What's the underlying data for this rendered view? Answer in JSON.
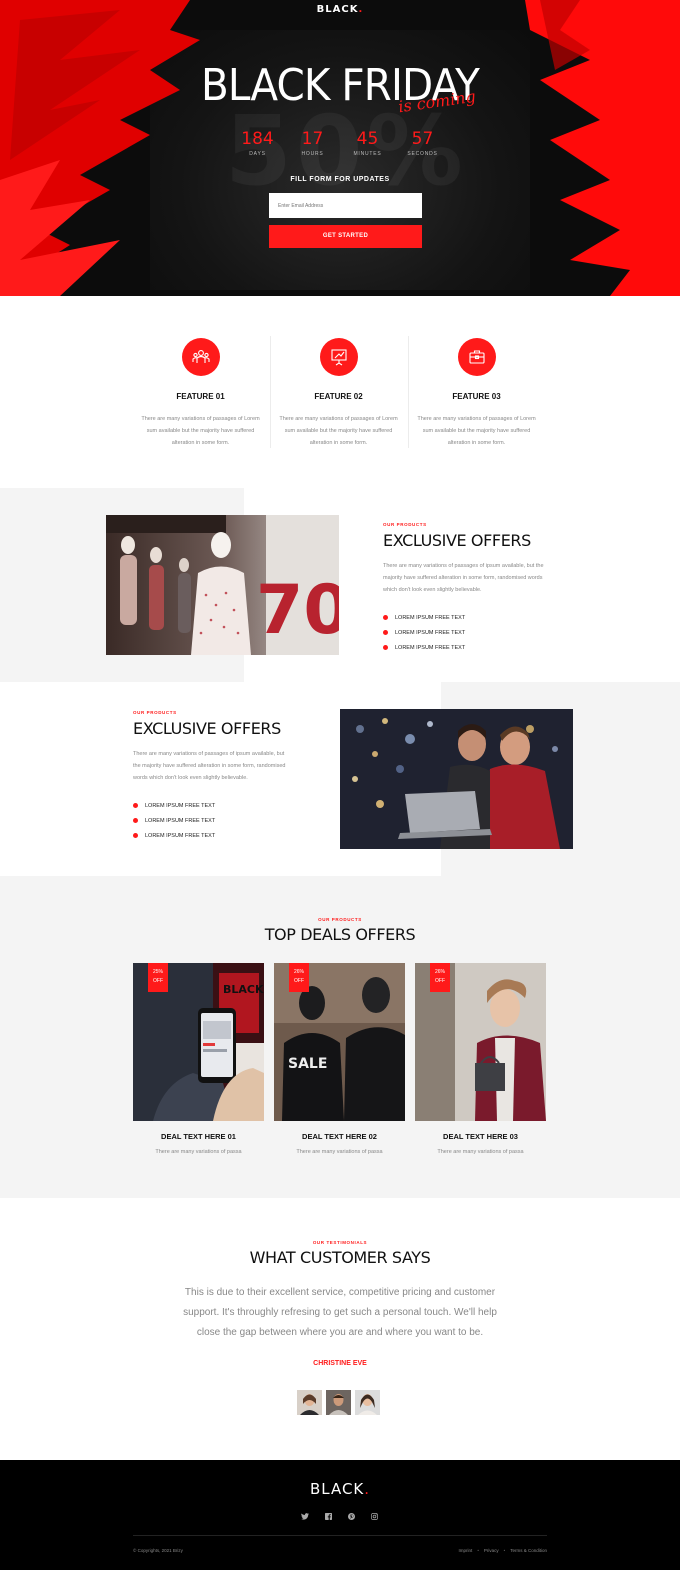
{
  "colors": {
    "accent": "#ff1a1a",
    "dark": "#0c0c0c",
    "light_grey": "#f4f4f4"
  },
  "hero": {
    "brand": "BLACK",
    "brand_dot": ".",
    "title": "BLACK FRIDAY",
    "script": "is coming",
    "background_text": "50%",
    "countdown": [
      {
        "value": "184",
        "label": "DAYS"
      },
      {
        "value": "17",
        "label": "HOURS"
      },
      {
        "value": "45",
        "label": "MINUTES"
      },
      {
        "value": "57",
        "label": "SECONDS"
      }
    ],
    "form_title": "FILL FORM FOR UPDATES",
    "email_placeholder": "Enter Email Address",
    "cta_label": "GET STARTED"
  },
  "features": [
    {
      "icon": "people-icon",
      "title": "FEATURE 01",
      "text": "There are many variations of passages of Lorem sum available but the majority have suffered alteration in some form."
    },
    {
      "icon": "presentation-icon",
      "title": "FEATURE 02",
      "text": "There are many variations of passages of Lorem sum available but the majority have suffered alteration in some form."
    },
    {
      "icon": "briefcase-icon",
      "title": "FEATURE 03",
      "text": "There are many variations of passages of Lorem sum available but the majority have suffered alteration in some form."
    }
  ],
  "offer_1": {
    "eyebrow": "OUR PRODUCTS",
    "title": "EXCLUSIVE OFFERS",
    "desc": "There are many variations of passages of ipsum available, but the majority have suffered alteration in some form, randomised words which don't look even slightly believable.",
    "list": [
      "LOREM IPSUM FREE TEXT",
      "LOREM IPSUM FREE TEXT",
      "LOREM IPSUM FREE TEXT"
    ],
    "photo_text": "70"
  },
  "offer_2": {
    "eyebrow": "OUR PRODUCTS",
    "title": "EXCLUSIVE OFFERS",
    "desc": "There are many variations of passages of ipsum available, but the majority have suffered alteration in some form, randomised words which don't look even slightly believable.",
    "list": [
      "LOREM IPSUM FREE TEXT",
      "LOREM IPSUM FREE TEXT",
      "LOREM IPSUM FREE TEXT"
    ]
  },
  "deals": {
    "eyebrow": "OUR PRODUCTS",
    "title": "TOP DEALS OFFERS",
    "cards": [
      {
        "badge_pct": "25%",
        "badge_off": "OFF",
        "title": "DEAL TEXT HERE 01",
        "text": "There are many variations of passa",
        "photo_text": "BLACK FRIDAY"
      },
      {
        "badge_pct": "26%",
        "badge_off": "OFF",
        "title": "DEAL TEXT HERE 02",
        "text": "There are many variations of passa",
        "photo_text": "SALE"
      },
      {
        "badge_pct": "26%",
        "badge_off": "OFF",
        "title": "DEAL TEXT HERE 03",
        "text": "There are many variations of passa"
      }
    ]
  },
  "testimonials": {
    "eyebrow": "OUR TESTIMONIALS",
    "title": "WHAT CUSTOMER SAYS",
    "quote": "This is due to their excellent service, competitive pricing and customer support. It's throughly refresing to get such a personal touch. We'll help close the gap between where you are and where you want to be.",
    "author": "CHRISTINE EVE"
  },
  "footer": {
    "brand": "BLACK",
    "brand_dot": ".",
    "socials": [
      "twitter-icon",
      "facebook-icon",
      "pinterest-icon",
      "instagram-icon"
    ],
    "copyright": "© Copyrights, 2021 Brizy",
    "links": [
      "Imprint",
      "Privacy",
      "Terms & Condition"
    ]
  }
}
